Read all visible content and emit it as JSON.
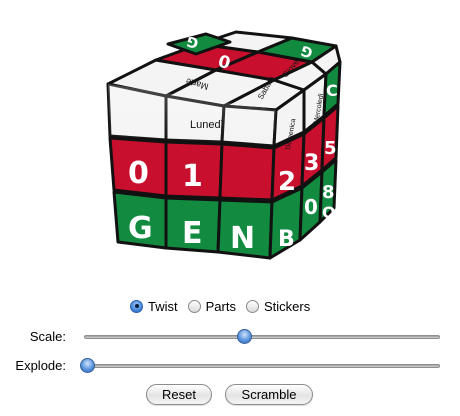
{
  "cube": {
    "colors": {
      "white": "#f7f7f7",
      "red": "#c8102e",
      "green": "#128a3f",
      "frame": "#111111"
    },
    "top_labels": {
      "label_a": "G",
      "label_b": "0",
      "label_c": "G",
      "label_d": "Marte",
      "label_e": "Giove",
      "label_f": "Sabato"
    },
    "front_labels": {
      "day_name": "Lunedì",
      "digit_0": "0",
      "digit_1": "1",
      "letter_g": "G",
      "letter_e": "E",
      "letter_n": "N"
    },
    "right_labels": {
      "word_v": "Mercoledì",
      "word_d": "Domenica",
      "digit_2": "2",
      "digit_3": "3",
      "digit_5": "5",
      "digit_8": "8",
      "digit_0b": "0",
      "letter_o": "O",
      "letter_c": "C",
      "letter_b": "B"
    }
  },
  "mode": {
    "options": [
      "Twist",
      "Parts",
      "Stickers"
    ],
    "selected": "Twist"
  },
  "sliders": {
    "scale": {
      "label": "Scale:",
      "value": 0.45
    },
    "explode": {
      "label": "Explode:",
      "value": 0.0
    }
  },
  "buttons": {
    "reset": "Reset",
    "scramble": "Scramble"
  }
}
